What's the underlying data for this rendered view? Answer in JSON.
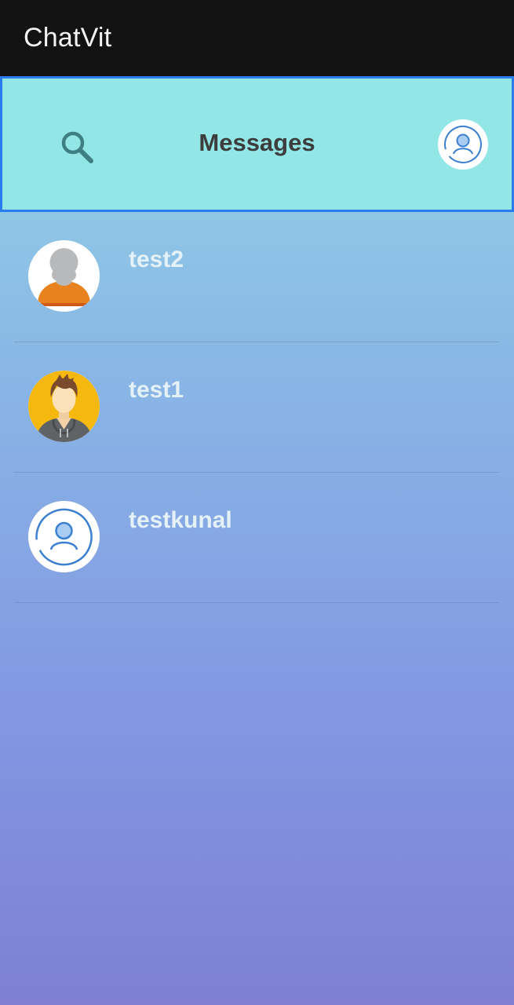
{
  "app": {
    "title": "ChatVit"
  },
  "header": {
    "title": "Messages",
    "search_icon": "search-icon",
    "profile_icon": "user-circle-icon"
  },
  "contacts": [
    {
      "name": "test2",
      "avatar": "default-person-orange"
    },
    {
      "name": "test1",
      "avatar": "man-avatar-yellow"
    },
    {
      "name": "testkunal",
      "avatar": "user-circle-icon"
    }
  ],
  "colors": {
    "app_bar": "#121212",
    "header_bg": "#93e6e6",
    "header_border": "#2a7cf0",
    "gradient_top": "#95dbe4",
    "gradient_bottom": "#7e7fd5",
    "name_text": "#e4f1f7",
    "title_text": "#3d3d3d"
  }
}
